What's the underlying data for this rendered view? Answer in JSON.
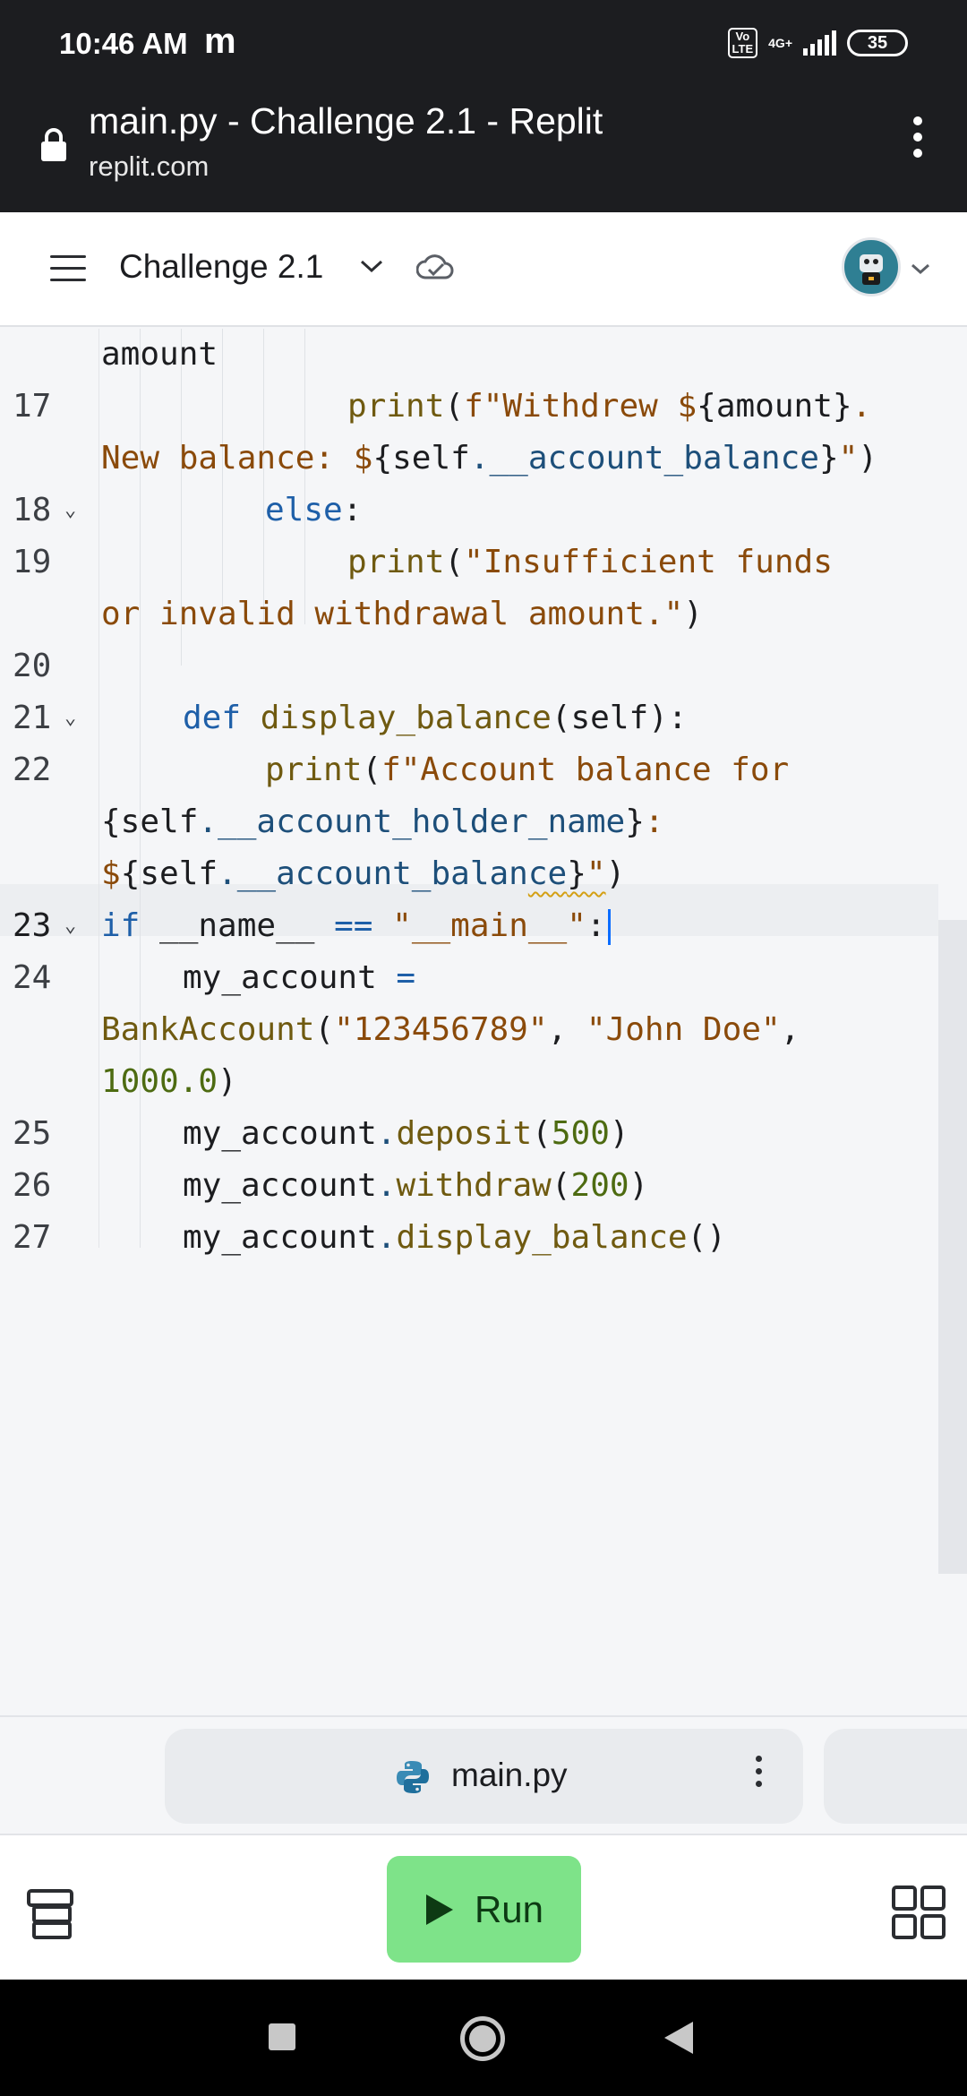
{
  "status_bar": {
    "time": "10:46 AM",
    "carrier_icon": "m",
    "volte": "Vo\nLTE",
    "network": "4G+",
    "battery": "35"
  },
  "browser": {
    "title": "main.py - Challenge 2.1 - Replit",
    "url": "replit.com"
  },
  "header": {
    "repl_name": "Challenge 2.1"
  },
  "editor": {
    "lines": [
      {
        "num": "",
        "text": "amount"
      },
      {
        "num": "17",
        "text": ""
      },
      {
        "num": "18",
        "text": ""
      },
      {
        "num": "19",
        "text": ""
      },
      {
        "num": "20",
        "text": ""
      },
      {
        "num": "21",
        "text": ""
      },
      {
        "num": "22",
        "text": ""
      },
      {
        "num": "23",
        "text": ""
      },
      {
        "num": "24",
        "text": ""
      },
      {
        "num": "25",
        "text": ""
      },
      {
        "num": "26",
        "text": ""
      },
      {
        "num": "27",
        "text": ""
      }
    ]
  },
  "file_tab": {
    "name": "main.py"
  },
  "toolbar": {
    "run_label": "Run"
  },
  "colors": {
    "run_bg": "#7ee389",
    "keyword": "#1e5fa8",
    "string": "#8a4a0a",
    "function": "#6f5a10",
    "number": "#4d6b11"
  }
}
